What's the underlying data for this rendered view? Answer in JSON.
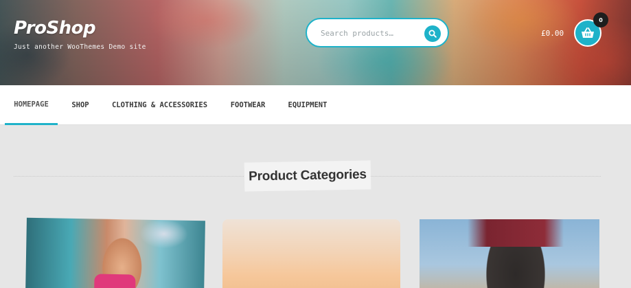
{
  "site": {
    "title": "ProShop",
    "tagline": "Just another WooThemes Demo site"
  },
  "search": {
    "placeholder": "Search products…",
    "icon": "search-icon"
  },
  "cart": {
    "total": "£0.00",
    "count": "0",
    "icon": "basket-icon"
  },
  "nav": {
    "items": [
      {
        "label": "HOMEPAGE",
        "active": true
      },
      {
        "label": "SHOP"
      },
      {
        "label": "CLOTHING & ACCESSORIES"
      },
      {
        "label": "FOOTWEAR"
      },
      {
        "label": "EQUIPMENT"
      }
    ]
  },
  "main": {
    "section_title": "Product Categories"
  },
  "colors": {
    "accent": "#1eb2c9",
    "nav_bg": "#ffffff",
    "page_bg": "#e6e6e6",
    "cart_badge": "#1e1e1e"
  }
}
